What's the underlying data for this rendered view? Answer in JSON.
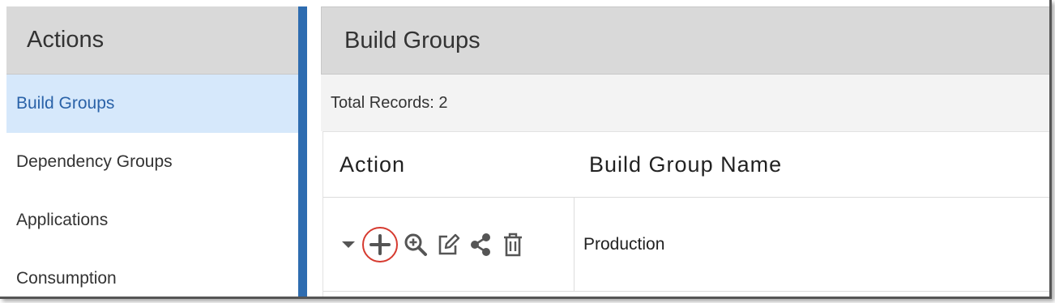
{
  "sidebar": {
    "title": "Actions",
    "items": [
      {
        "label": "Build Groups",
        "active": true
      },
      {
        "label": "Dependency Groups",
        "active": false
      },
      {
        "label": "Applications",
        "active": false
      },
      {
        "label": "Consumption",
        "active": false
      }
    ]
  },
  "main": {
    "title": "Build Groups",
    "total_records": "Total Records: 2",
    "table": {
      "columns": [
        "Action",
        "Build Group Name"
      ],
      "rows": [
        {
          "actions": [
            "caret-down-icon",
            "plus-icon",
            "zoom-in-icon",
            "edit-icon",
            "share-icon",
            "trash-icon"
          ],
          "name": "Production"
        }
      ]
    }
  },
  "colors": {
    "accent_bar": "#2e6cb0",
    "active_item_bg": "#d6e8fb",
    "active_item_text": "#2a62a8",
    "header_bg": "#d9d9d9",
    "highlight_ring": "#d63a2f"
  }
}
